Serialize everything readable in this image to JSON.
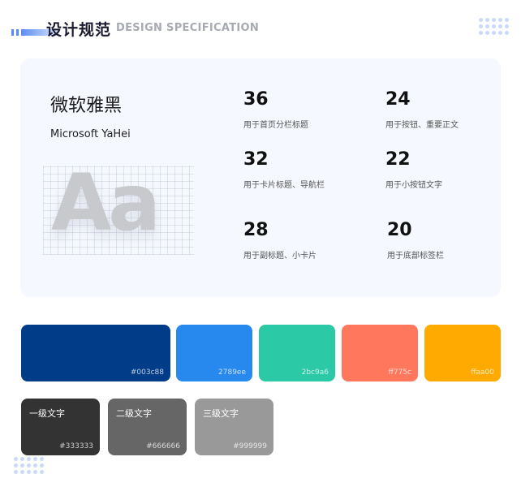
{
  "header": {
    "title_cn": "设计规范",
    "title_en": "DESIGN SPECIFICATION"
  },
  "typography": {
    "font_name_cn": "微软雅黑",
    "font_name_en": "Microsoft YaHei",
    "sample": "Aa",
    "sizes": [
      {
        "size": "36",
        "usage": "用于首页分栏标题"
      },
      {
        "size": "24",
        "usage": "用于按钮、重要正文"
      },
      {
        "size": "32",
        "usage": "用于卡片标题、导航栏"
      },
      {
        "size": "22",
        "usage": "用于小按钮文字"
      },
      {
        "size": "28",
        "usage": "用于副标题、小卡片"
      },
      {
        "size": "20",
        "usage": "用于底部标签栏"
      }
    ]
  },
  "colors": [
    {
      "hex": "#003c88",
      "color": "#003c88"
    },
    {
      "hex": "2789ee",
      "color": "#2789ee"
    },
    {
      "hex": "2bc9a6",
      "color": "#2bc9a6"
    },
    {
      "hex": "ff775c",
      "color": "#ff775c"
    },
    {
      "hex": "ffaa00",
      "color": "#ffaa00"
    }
  ],
  "text_colors": [
    {
      "label": "一级文字",
      "hex": "#333333",
      "color": "#333333"
    },
    {
      "label": "二级文字",
      "hex": "#666666",
      "color": "#666666"
    },
    {
      "label": "三级文字",
      "hex": "#999999",
      "color": "#999999"
    }
  ]
}
